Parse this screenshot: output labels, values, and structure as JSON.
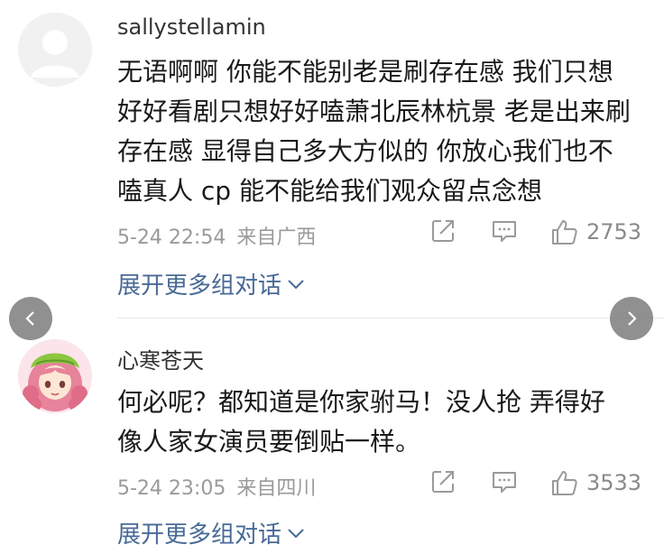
{
  "comments": [
    {
      "username": "sallystellamin",
      "lines": [
        "无语啊啊 你能不能别老是刷存在感 我们只想",
        "好好看剧只想好好嗑萧北辰林杭景 老是出来刷",
        "存在感 显得自己多大方似的 你放心我们也不",
        "嗑真人 cp 能不能给我们观众留点念想"
      ],
      "time": "5-24 22:54",
      "location": "来自广西",
      "likes": "2753",
      "expand_label": "展开更多组对话"
    },
    {
      "username": "心寒苍天",
      "lines": [
        "何必呢？都知道是你家驸马！没人抢 弄得好",
        "像人家女演员要倒贴一样。"
      ],
      "time": "5-24 23:05",
      "location": "来自四川",
      "likes": "3533",
      "expand_label": "展开更多组对话"
    }
  ],
  "icons": {
    "share": "share-icon",
    "comment": "comment-icon",
    "like": "thumbs-up-icon",
    "expand": "chevron-down-icon",
    "prev": "chevron-left-icon",
    "next": "chevron-right-icon"
  },
  "colors": {
    "link": "#486a96",
    "meta": "#9a9a9a",
    "nav_button": "#7a7a7a"
  }
}
